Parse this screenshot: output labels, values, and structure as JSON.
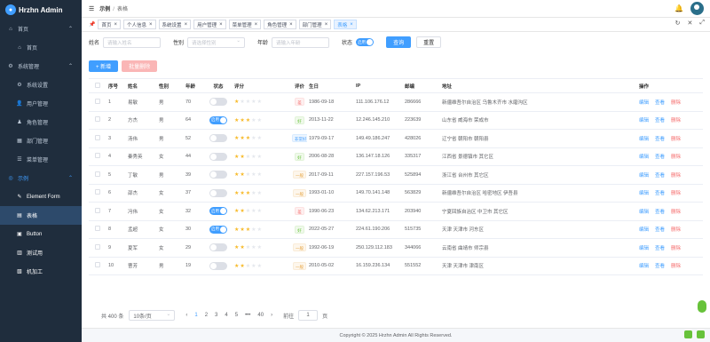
{
  "app": {
    "title": "Hrzhn Admin"
  },
  "sidebar": {
    "items": [
      {
        "label": "首页",
        "icon": "home-icon",
        "level": 1,
        "arrow": "⌃"
      },
      {
        "label": "首页",
        "icon": "home-icon",
        "level": 2
      },
      {
        "label": "系统管理",
        "icon": "gear-icon",
        "level": 1,
        "arrow": "⌃"
      },
      {
        "label": "系统设置",
        "icon": "gear-icon",
        "level": 2
      },
      {
        "label": "用户管理",
        "icon": "user-icon",
        "level": 2
      },
      {
        "label": "角色管理",
        "icon": "role-icon",
        "level": 2
      },
      {
        "label": "部门管理",
        "icon": "dept-icon",
        "level": 2
      },
      {
        "label": "菜单管理",
        "icon": "menu-icon",
        "level": 2
      },
      {
        "label": "示例",
        "icon": "example-icon",
        "level": 1,
        "arrow": "⌃"
      },
      {
        "label": "Element Form",
        "icon": "form-icon",
        "level": 2
      },
      {
        "label": "表格",
        "icon": "table-icon",
        "level": 2
      },
      {
        "label": "Button",
        "icon": "button-icon",
        "level": 2
      },
      {
        "label": "测试用",
        "icon": "test-icon",
        "level": 2
      },
      {
        "label": "机加工",
        "icon": "machining-icon",
        "level": 2
      }
    ]
  },
  "header": {
    "breadcrumb_root": "示例",
    "breadcrumb_sep": "/",
    "breadcrumb_current": "表格"
  },
  "tags": [
    {
      "label": "首页",
      "active": false
    },
    {
      "label": "个人信息",
      "active": false
    },
    {
      "label": "系统设置",
      "active": false
    },
    {
      "label": "用户管理",
      "active": false
    },
    {
      "label": "菜单管理",
      "active": false
    },
    {
      "label": "角色管理",
      "active": false
    },
    {
      "label": "部门管理",
      "active": false
    },
    {
      "label": "表格",
      "active": true
    }
  ],
  "filters": {
    "name_label": "姓名",
    "name_placeholder": "请输入姓名",
    "sex_label": "性别",
    "sex_placeholder": "请选择性别",
    "age_label": "年龄",
    "age_placeholder": "请输入年龄",
    "status_label": "状态",
    "status_switch_text": "启用",
    "search_button": "查询",
    "reset_button": "重置"
  },
  "actions": {
    "add_button": "+ 新增",
    "batch_delete_button": "批量删除"
  },
  "table": {
    "headers": {
      "no": "序号",
      "name": "姓名",
      "sex": "性别",
      "age": "年龄",
      "status": "状态",
      "rating": "评分",
      "evaluation": "评价",
      "birth": "生日",
      "ip": "IP",
      "mail": "邮编",
      "address": "地址",
      "operation": "操作"
    },
    "op_labels": {
      "edit": "编辑",
      "view": "查看",
      "delete": "删除"
    },
    "rows": [
      {
        "no": "1",
        "name": "易敏",
        "sex": "男",
        "age": "70",
        "status": false,
        "rating": 1,
        "eval": "差",
        "eval_type": "bad",
        "birth": "1986-09-18",
        "ip": "111.106.176.12",
        "mail": "286666",
        "address": "新疆维吾尔自治区 乌鲁木齐市 水磨沟区"
      },
      {
        "no": "2",
        "name": "方杰",
        "sex": "男",
        "age": "64",
        "status": true,
        "rating": 3,
        "eval": "好",
        "eval_type": "good",
        "birth": "2013-11-22",
        "ip": "12.246.145.210",
        "mail": "223639",
        "address": "山东省 威海市 荣成市"
      },
      {
        "no": "3",
        "name": "汤伟",
        "sex": "男",
        "age": "52",
        "status": false,
        "rating": 3,
        "eval": "非常好",
        "eval_type": "vgood",
        "birth": "1979-09-17",
        "ip": "149.49.186.247",
        "mail": "428026",
        "address": "辽宁省 朝阳市 朝阳县"
      },
      {
        "no": "4",
        "name": "秦秀英",
        "sex": "女",
        "age": "44",
        "status": false,
        "rating": 2,
        "eval": "好",
        "eval_type": "good",
        "birth": "2006-08-28",
        "ip": "136.147.18.126",
        "mail": "335317",
        "address": "江西省 景德镇市 其它区"
      },
      {
        "no": "5",
        "name": "丁敏",
        "sex": "男",
        "age": "39",
        "status": false,
        "rating": 2,
        "eval": "一般",
        "eval_type": "ok",
        "birth": "2017-09-11",
        "ip": "227.157.196.53",
        "mail": "525894",
        "address": "浙江省 台州市 其它区"
      },
      {
        "no": "6",
        "name": "邵杰",
        "sex": "女",
        "age": "37",
        "status": false,
        "rating": 3,
        "eval": "一般",
        "eval_type": "ok",
        "birth": "1993-01-10",
        "ip": "149.70.141.148",
        "mail": "563829",
        "address": "新疆维吾尔自治区 哈密地区 伊吾县"
      },
      {
        "no": "7",
        "name": "冯伟",
        "sex": "女",
        "age": "32",
        "status": true,
        "rating": 2,
        "eval": "差",
        "eval_type": "bad",
        "birth": "1990-06-23",
        "ip": "134.62.213.171",
        "mail": "203940",
        "address": "宁夏回族自治区 中卫市 其它区"
      },
      {
        "no": "8",
        "name": "孟超",
        "sex": "女",
        "age": "30",
        "status": true,
        "rating": 3,
        "eval": "好",
        "eval_type": "good",
        "birth": "2022-05-27",
        "ip": "224.61.190.206",
        "mail": "515735",
        "address": "天津 天津市 河东区"
      },
      {
        "no": "9",
        "name": "夏军",
        "sex": "女",
        "age": "29",
        "status": false,
        "rating": 2,
        "eval": "一般",
        "eval_type": "ok",
        "birth": "1992-06-19",
        "ip": "250.129.112.183",
        "mail": "344066",
        "address": "云南省 曲靖市 师宗县"
      },
      {
        "no": "10",
        "name": "曹芳",
        "sex": "男",
        "age": "19",
        "status": false,
        "rating": 2,
        "eval": "一般",
        "eval_type": "ok",
        "birth": "2010-05-02",
        "ip": "16.159.236.134",
        "mail": "551552",
        "address": "天津 天津市 津南区"
      }
    ]
  },
  "pagination": {
    "total_text": "共 400 条",
    "page_size": "10条/页",
    "prev": "‹",
    "pages": [
      "1",
      "2",
      "3",
      "4",
      "5",
      "•••",
      "40"
    ],
    "current": "1",
    "next": "›",
    "goto_label": "前往",
    "goto_value": "1",
    "goto_suffix": "页"
  },
  "footer": {
    "text": "Copyright © 2025 Hrzhn Admin All Rights Reserved."
  },
  "colors": {
    "sidebar_bg": "#1f2d3d",
    "accent": "#409eff",
    "danger": "#f56c6c",
    "success": "#67c23a",
    "warning": "#e6a23c",
    "star": "#f7ba2a"
  }
}
